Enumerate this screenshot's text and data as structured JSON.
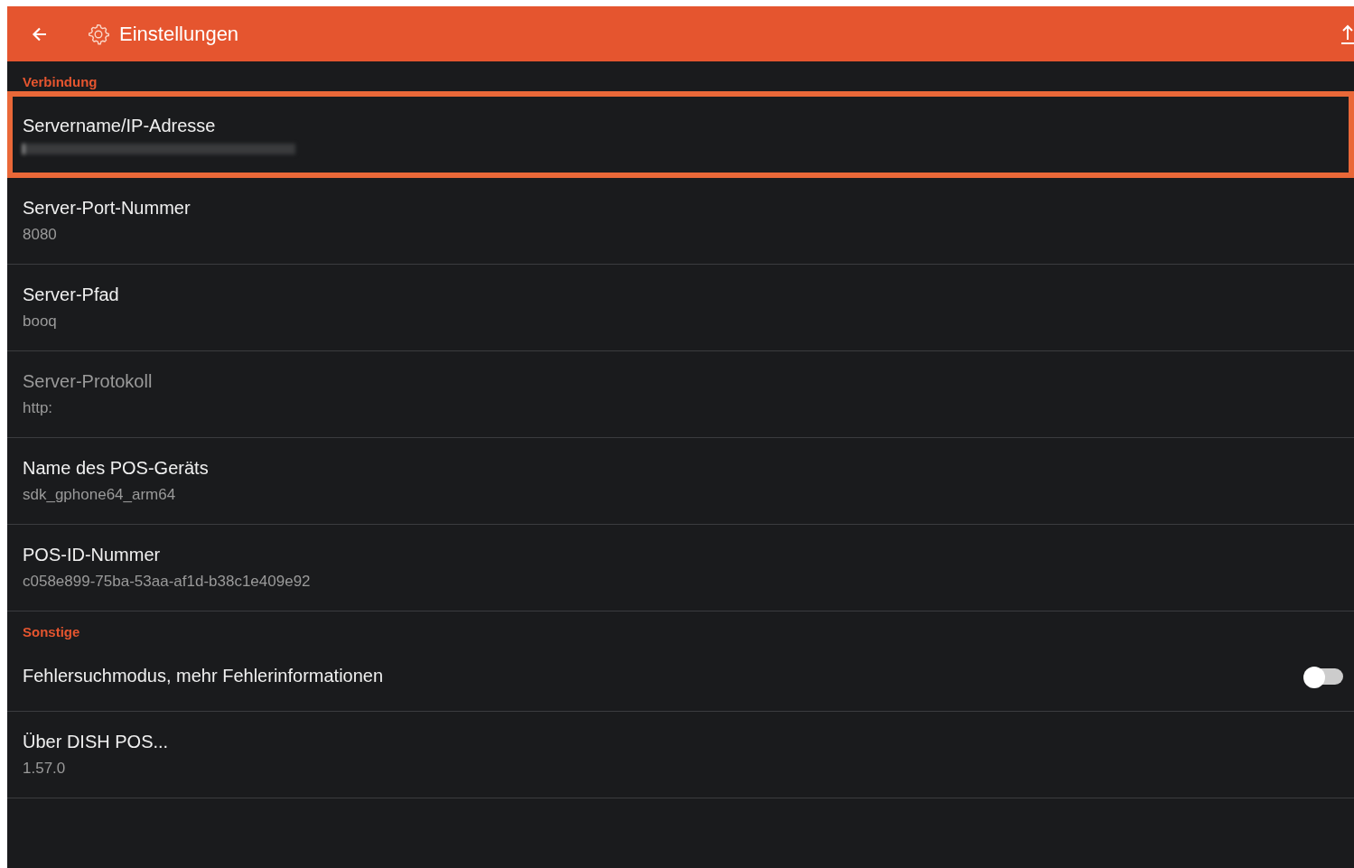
{
  "app_bar": {
    "title": "Einstellungen"
  },
  "sections": [
    {
      "title": "Verbindung",
      "items": [
        {
          "kind": "value",
          "title": "Servername/IP-Adresse",
          "redacted": true,
          "selected": true,
          "disabled": false
        },
        {
          "kind": "value",
          "title": "Server-Port-Nummer",
          "value": "8080",
          "selected": false,
          "disabled": false
        },
        {
          "kind": "value",
          "title": "Server-Pfad",
          "value": "booq",
          "selected": false,
          "disabled": false
        },
        {
          "kind": "value",
          "title": "Server-Protokoll",
          "value": "http:",
          "selected": false,
          "disabled": true
        },
        {
          "kind": "value",
          "title": "Name des POS-Geräts",
          "value": "sdk_gphone64_arm64",
          "selected": false,
          "disabled": false
        },
        {
          "kind": "value",
          "title": "POS-ID-Nummer",
          "value": "c058e899-75ba-53aa-af1d-b38c1e409e92",
          "selected": false,
          "disabled": false
        }
      ]
    },
    {
      "title": "Sonstige",
      "items": [
        {
          "kind": "toggle",
          "title": "Fehlersuchmodus, mehr Fehlerinformationen",
          "on": false,
          "selected": false,
          "disabled": false
        },
        {
          "kind": "value",
          "title": "Über DISH POS...",
          "value": "1.57.0",
          "selected": false,
          "disabled": false
        }
      ]
    }
  ]
}
